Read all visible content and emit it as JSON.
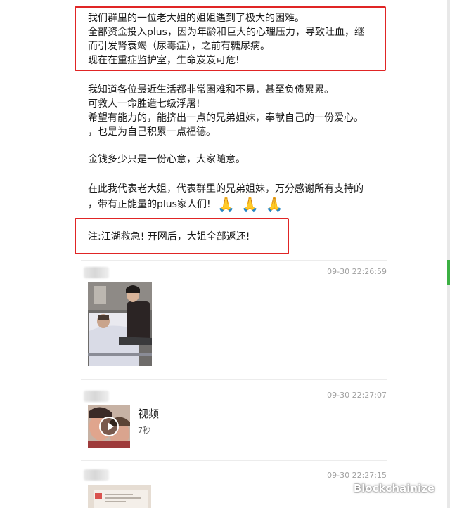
{
  "post": {
    "box1_lines": [
      "我们群里的一位老大姐的姐姐遇到了极大的困难。",
      "全部资金投入plus，因为年龄和巨大的心理压力，导致吐血，继",
      "而引发肾衰竭（尿毒症），之前有糖尿病。",
      "现在在重症监护室，生命岌岌可危!"
    ],
    "para2_lines": [
      "我知道各位最近生活都非常困难和不易，甚至负债累累。",
      "可救人一命胜造七级浮屠!",
      "希望有能力的，能挤出一点的兄弟姐妹，奉献自己的一份爱心。",
      "，也是为自己积累一点福德。"
    ],
    "para3": "金钱多少只是一份心意，大家随意。",
    "para4_line1": "在此我代表老大姐，代表群里的兄弟姐妹，万分感谢所有支持的",
    "para4_line2": "，带有正能量的plus家人们!",
    "note": "注:江湖救急!  开网后，大姐全部返还!"
  },
  "entries": [
    {
      "timestamp": "09-30 22:26:59",
      "type": "image"
    },
    {
      "timestamp": "09-30 22:27:07",
      "type": "video",
      "video_title": "视频",
      "video_duration": "7秒"
    },
    {
      "timestamp": "09-30 22:27:15",
      "type": "image"
    }
  ],
  "watermark": {
    "text": "Blockchainize",
    "icon": "wechat-icon"
  },
  "colors": {
    "highlight_box": "#e02525",
    "timestamp": "#a0a0a0"
  }
}
